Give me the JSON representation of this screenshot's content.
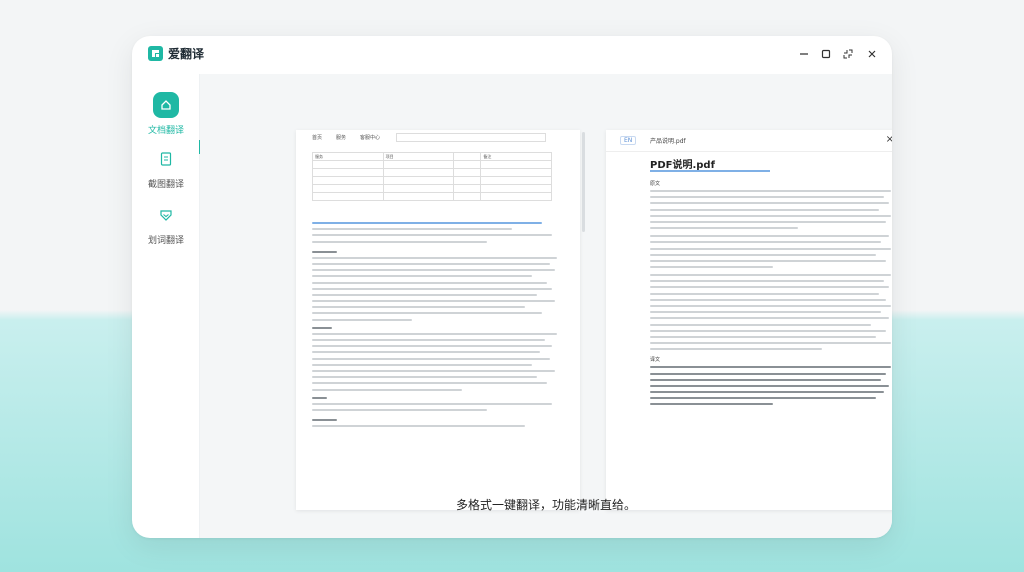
{
  "app": {
    "title": "爱翻译",
    "brand_color": "#1fb8a4"
  },
  "window_controls": [
    "minimize",
    "maximize",
    "restore",
    "close"
  ],
  "sidebar": {
    "items": [
      {
        "label": "文档翻译",
        "icon": "home-icon",
        "active": true
      },
      {
        "label": "截图翻译",
        "icon": "document-icon",
        "active": false
      },
      {
        "label": "划词翻译",
        "icon": "check-shield-icon",
        "active": false
      }
    ]
  },
  "left_doc": {
    "tabs": [
      "首页",
      "服务",
      "客服中心"
    ],
    "table_headers": [
      "服务",
      "项目",
      "备注"
    ]
  },
  "right_doc": {
    "lang_badge": "EN",
    "file_name": "产品说明.pdf",
    "title": "PDF说明.pdf",
    "section_original": "原文",
    "section_translation": "译文"
  },
  "caption": "多格式一键翻译，功能清晰直给。"
}
